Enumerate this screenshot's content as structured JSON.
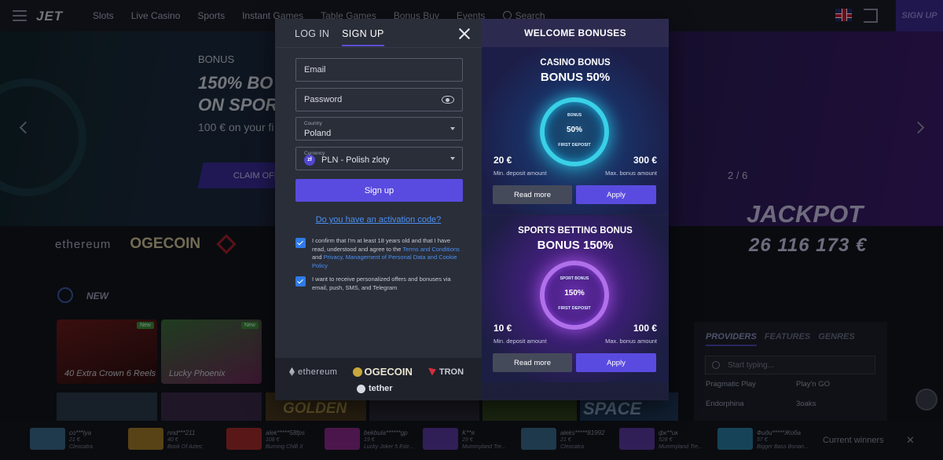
{
  "topbar": {
    "logo": "JET",
    "nav": [
      "Slots",
      "Live Casino",
      "Sports",
      "Instant Games",
      "Table Games",
      "Bonus Buy",
      "Events"
    ],
    "search_label": "Search",
    "signup_label": "SIGN UP"
  },
  "hero": {
    "kicker": "BONUS",
    "title_line1": "150% BO",
    "title_line2": "ON SPOR",
    "subtitle": "100 € on your fi",
    "claim_label": "CLAIM OFFE",
    "pager": "2 / 6"
  },
  "crypto": {
    "eth": "ethereum",
    "doge": "OGECOIN"
  },
  "jackpot": {
    "label": "JACKPOT",
    "value": "26 116 173 €"
  },
  "new_label": "NEW",
  "games": [
    {
      "name": "40 Extra Crown 6 Reels",
      "badge": "New"
    },
    {
      "name": "Lucky Phoenix",
      "badge": "New"
    }
  ],
  "strip_texts": {
    "golden": "GOLDEN",
    "space": "SPACE"
  },
  "providers": {
    "tabs": [
      "PROVIDERS",
      "FEATURES",
      "GENRES"
    ],
    "search_placeholder": "Start typing...",
    "items": [
      "Pragmatic Play",
      "Play'n GO",
      "Endorphina",
      "3oaks"
    ]
  },
  "winners": {
    "label": "Current winners",
    "close": "✕",
    "items": [
      {
        "name": "co***lya",
        "amount": "21 €",
        "game": "Cleocatra",
        "color": "#3a6a8a"
      },
      {
        "name": "nnd***211",
        "amount": "40 €",
        "game": "Book Of Aztec",
        "color": "#a07a2a"
      },
      {
        "name": "alek*****58fps",
        "amount": "108 €",
        "game": "Burning Chilli X",
        "color": "#a22a2a"
      },
      {
        "name": "bekbula******gp",
        "amount": "19 €",
        "game": "Lucky Joker 5 Extr...",
        "color": "#8a2a8a"
      },
      {
        "name": "K**я",
        "amount": "29 €",
        "game": "Mummyland Tre...",
        "color": "#5a3aa0"
      },
      {
        "name": "aleks*****81992",
        "amount": "21 €",
        "game": "Cleocatra",
        "color": "#3a6a8a"
      },
      {
        "name": "фк**ик",
        "amount": "528 €",
        "game": "Mummyland Tre...",
        "color": "#5a3aa0"
      },
      {
        "name": "Фиди*****Жоба",
        "amount": "57 €",
        "game": "Bigger Bass Bonan...",
        "color": "#2a7aa0"
      }
    ]
  },
  "modal": {
    "tabs": {
      "login": "LOG IN",
      "signup": "SIGN UP"
    },
    "email_placeholder": "Email",
    "password_placeholder": "Password",
    "country_label": "Country",
    "country_value": "Poland",
    "currency_label": "Currency",
    "currency_icon": "zł",
    "currency_value": "PLN - Polish zloty",
    "signup_button": "Sign up",
    "activation_link": "Do you have an activation code?",
    "consent1_a": "I confirm that I'm at least 18 years old and that I have read, understood and agree to the ",
    "consent1_terms": "Terms and Conditions",
    "consent1_and": " and ",
    "consent1_privacy": "Privacy, Management of Personal Data and Cookie Policy",
    "consent2": "I want to receive personalized offers and bonuses via email, push, SMS, and Telegram",
    "consent1_checked": true,
    "consent2_checked": true,
    "footer_logos": {
      "eth": "ethereum",
      "doge": "OGECOIN",
      "tron": "TRON",
      "tether": "tether"
    }
  },
  "bonuses": {
    "header": "WELCOME BONUSES",
    "cards": [
      {
        "title": "CASINO BONUS",
        "big": "BONUS 50%",
        "ring_top": "BONUS",
        "ring_value": "50%",
        "ring_bottom": "FIRST DEPOSIT",
        "min_amount": "20 €",
        "min_label": "Min. deposit amount",
        "max_amount": "300 €",
        "max_label": "Max. bonus amount",
        "read_more": "Read more",
        "apply": "Apply"
      },
      {
        "title": "SPORTS BETTING BONUS",
        "big": "BONUS 150%",
        "ring_top": "SPORT BONUS",
        "ring_value": "150%",
        "ring_bottom": "FIRST DEPOSIT",
        "min_amount": "10 €",
        "min_label": "Min. deposit amount",
        "max_amount": "100 €",
        "max_label": "Max. bonus amount",
        "read_more": "Read more",
        "apply": "Apply"
      }
    ]
  },
  "colors": {
    "accent": "#5a4be0",
    "link": "#4b8ff0",
    "checkbox": "#2f7be6",
    "form_bg": "#2a2e39",
    "bonus_bg": "#242748"
  }
}
